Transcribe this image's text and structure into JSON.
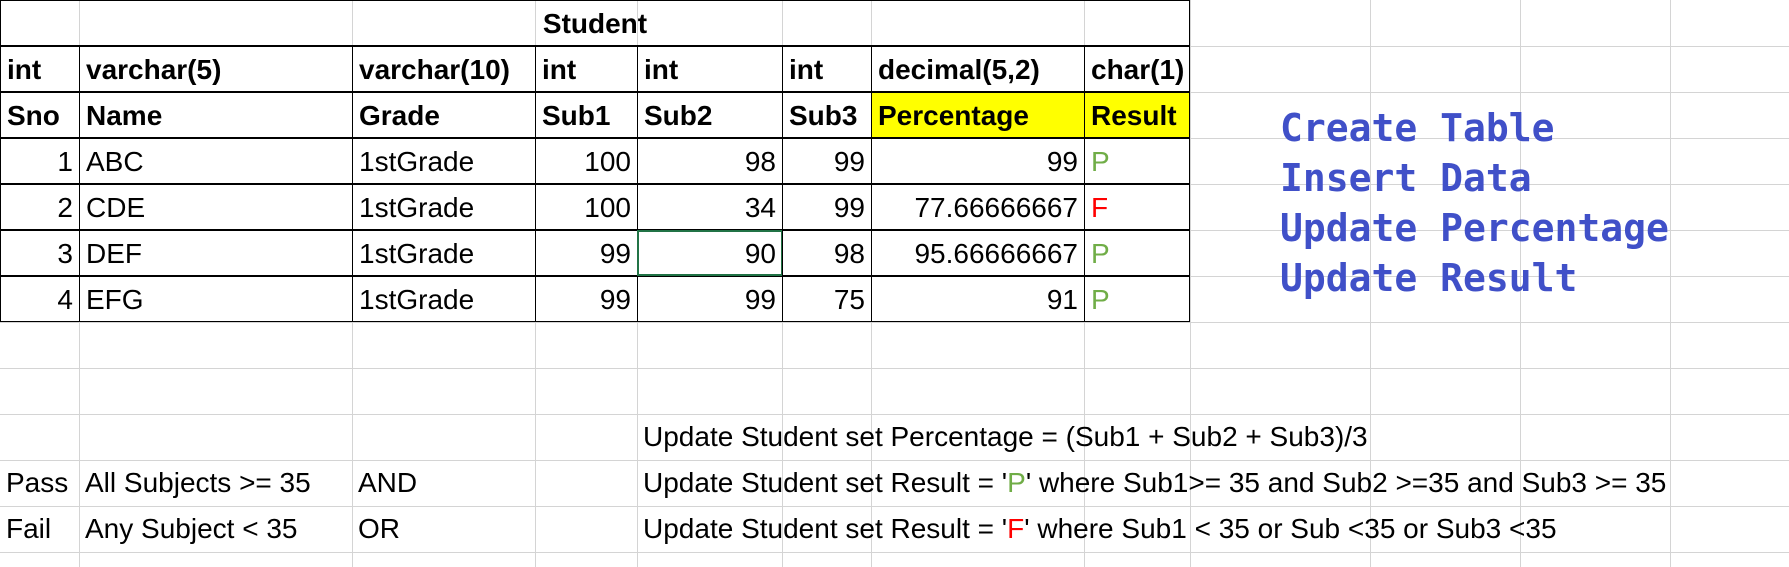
{
  "table": {
    "title": "Student",
    "types": [
      "int",
      "varchar(5)",
      "varchar(10)",
      "int",
      "int",
      "int",
      "decimal(5,2)",
      "char(1)"
    ],
    "headers": [
      "Sno",
      "Name",
      "Grade",
      "Sub1",
      "Sub2",
      "Sub3",
      "Percentage",
      "Result"
    ],
    "rows": [
      [
        "1",
        "ABC",
        "1stGrade",
        "100",
        "98",
        "99",
        "99",
        "P"
      ],
      [
        "2",
        "CDE",
        "1stGrade",
        "100",
        "34",
        "99",
        "77.66666667",
        "F"
      ],
      [
        "3",
        "DEF",
        "1stGrade",
        "99",
        "90",
        "98",
        "95.66666667",
        "P"
      ],
      [
        "4",
        "EFG",
        "1stGrade",
        "99",
        "99",
        "75",
        "91",
        "P"
      ]
    ]
  },
  "steps": [
    "Create Table",
    "Insert Data",
    "Update Percentage",
    "Update Result"
  ],
  "rules": {
    "pass": {
      "label": "Pass",
      "condition": "All Subjects >= 35",
      "op": "AND"
    },
    "fail": {
      "label": "Fail",
      "condition": "Any Subject < 35",
      "op": "OR"
    }
  },
  "sql": {
    "percentage": "Update Student set Percentage = (Sub1 + Sub2 + Sub3)/3",
    "result_p": {
      "pre": "Update Student set Result = '",
      "val": "P",
      "post": "' where Sub1>= 35 and Sub2 >=35 and Sub3 >= 35"
    },
    "result_f": {
      "pre": "Update Student set Result = '",
      "val": "F",
      "post": "' where Sub1 < 35 or Sub <35 or Sub3 <35"
    }
  },
  "colors": {
    "result_pass": "#70ad47",
    "result_fail": "#ff0000",
    "header_highlight": "#ffff00",
    "steps_text": "#4050c8"
  }
}
